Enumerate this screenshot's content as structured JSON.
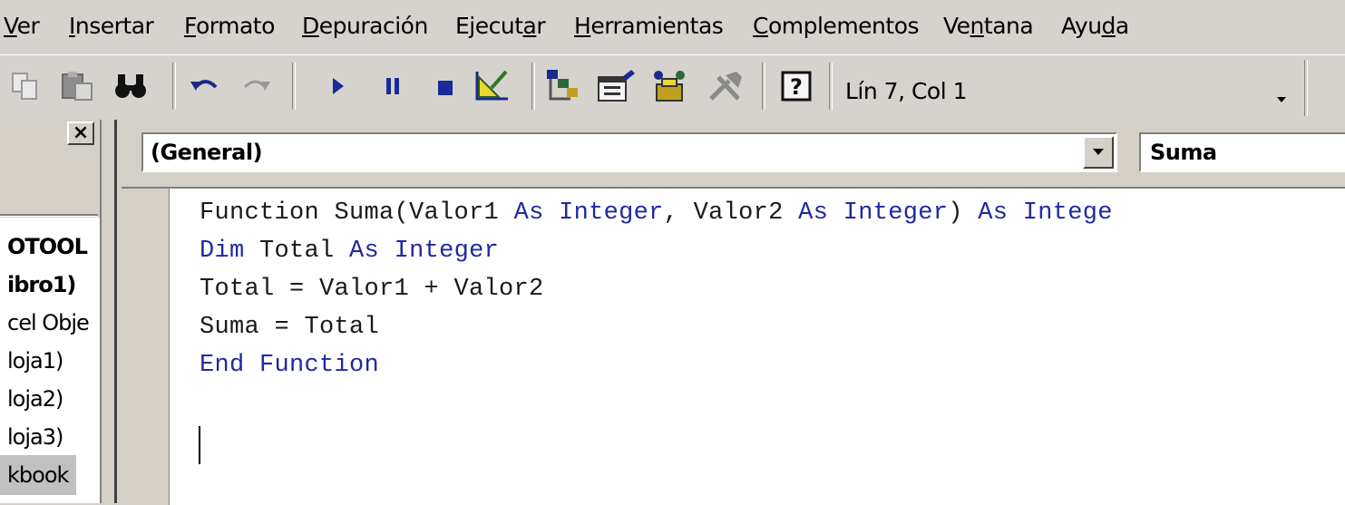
{
  "menu": {
    "items": [
      {
        "label": "Ver"
      },
      {
        "label": "Insertar"
      },
      {
        "label": "Formato"
      },
      {
        "label": "Depuración"
      },
      {
        "label": "Ejecutar"
      },
      {
        "label": "Herramientas"
      },
      {
        "label": "Complementos"
      },
      {
        "label": "Ventana"
      },
      {
        "label": "Ayuda"
      }
    ]
  },
  "toolbar": {
    "position_label": "Lín 7, Col 1",
    "icons": [
      "copy-icon",
      "paste-icon",
      "find-icon",
      "undo-icon",
      "redo-icon",
      "run-icon",
      "pause-icon",
      "stop-icon",
      "design-mode-icon",
      "project-explorer-icon",
      "properties-icon",
      "object-browser-icon",
      "toolbox-icon",
      "help-icon"
    ]
  },
  "project_panel": {
    "close_label": "×",
    "tree": [
      {
        "label": "OTOOL"
      },
      {
        "label": "ibro1)"
      },
      {
        "label": "cel Obje"
      },
      {
        "label": "loja1)"
      },
      {
        "label": "loja2)"
      },
      {
        "label": "loja3)"
      },
      {
        "label": "kbook"
      }
    ]
  },
  "code_window": {
    "object_combo": "(General)",
    "procedure_combo": "Suma",
    "lines": [
      [
        {
          "t": "Function Suma(Valor1 ",
          "k": false
        },
        {
          "t": "As",
          "k": true
        },
        {
          "t": " ",
          "k": false
        },
        {
          "t": "Integer",
          "k": true
        },
        {
          "t": ", Valor2 ",
          "k": false
        },
        {
          "t": "As",
          "k": true
        },
        {
          "t": " ",
          "k": false
        },
        {
          "t": "Integer",
          "k": true
        },
        {
          "t": ") ",
          "k": false
        },
        {
          "t": "As",
          "k": true
        },
        {
          "t": " ",
          "k": false
        },
        {
          "t": "Intege",
          "k": true
        }
      ],
      [
        {
          "t": "Dim",
          "k": true
        },
        {
          "t": " Total ",
          "k": false
        },
        {
          "t": "As",
          "k": true
        },
        {
          "t": " ",
          "k": false
        },
        {
          "t": "Integer",
          "k": true
        }
      ],
      [
        {
          "t": "Total = Valor1 + Valor2",
          "k": false
        }
      ],
      [
        {
          "t": "Suma = Total",
          "k": false
        }
      ],
      [
        {
          "t": "End Function",
          "k": true
        }
      ]
    ]
  },
  "colors": {
    "keyword": "#1f2aa0",
    "chrome": "#d4d0c8"
  }
}
